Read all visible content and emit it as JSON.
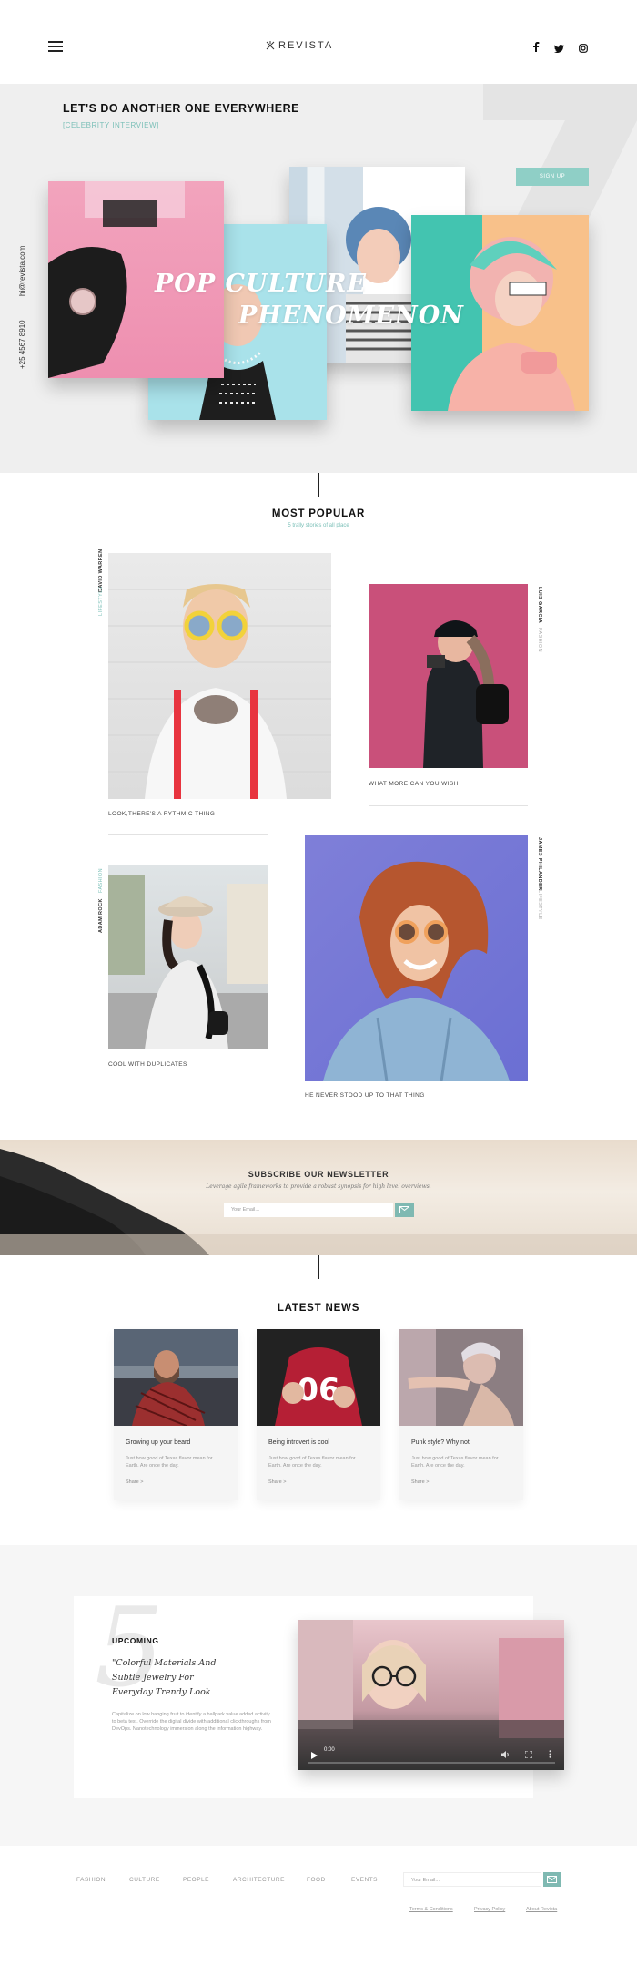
{
  "header": {
    "logo_text": "REVISTA",
    "social": {
      "facebook": "f",
      "twitter": "t",
      "instagram": "ig"
    }
  },
  "hero": {
    "title": "LET'S DO ANOTHER ONE EVERYWHERE",
    "subtitle": "[CELEBRITY INTERVIEW]",
    "cta_label": "SIGN UP",
    "headline_line1": "POP CULTURE",
    "headline_line2": "PHENOMENON",
    "contact_email": "hi@revista.com",
    "contact_phone": "+25 4567 8910"
  },
  "popular": {
    "title": "MOST POPULAR",
    "subtitle": "5 trally stories of all place",
    "items": [
      {
        "caption": "LOOK,THERE'S A RYTHMIC THING",
        "author": "DAVID WARREN",
        "tag": "LIFESTYLE"
      },
      {
        "caption": "WHAT MORE CAN YOU WISH",
        "author": "LUIS GARCIA",
        "tag": "FASHION"
      },
      {
        "caption": "COOL WITH DUPLICATES",
        "author": "ADAM ROCK",
        "tag": "FASHION"
      },
      {
        "caption": "HE NEVER STOOD UP TO THAT THING",
        "author": "JAMES PHILANDER",
        "tag": "LIFESTYLE"
      }
    ]
  },
  "newsletter": {
    "title": "SUBSCRIBE OUR NEWSLETTER",
    "subtitle": "Leverage agile frameworks to provide a robust synopsis for high level overviews.",
    "placeholder": "Your Email..."
  },
  "latest_news": {
    "title": "LATEST NEWS",
    "cards": [
      {
        "title": "Growing up your beard",
        "text": "Just how good of Texas flavor mean for Earth. Are once the day.",
        "link": "Share  >"
      },
      {
        "title": "Being introvert is cool",
        "text": "Just how good of Texas flavor mean for Earth. Are once the day.",
        "link": "Share  >"
      },
      {
        "title": "Punk style? Why not",
        "text": "Just how good of Texas flavor mean for Earth. Are once the day.",
        "link": "Share  >"
      }
    ]
  },
  "upcoming": {
    "number": "5",
    "label": "UPCOMING",
    "quote": "\"Colorful Materials And Subtle Jewelry For Everyday Trendy Look",
    "text": "Capitalize on low hanging fruit to identify a ballpark value added activity to beta test. Override the digital divide with additional clickthroughs from DevOps. Nanotechnology immersion along the information highway.",
    "video_time": "0:00"
  },
  "footer": {
    "nav": [
      "FASHION",
      "CULTURE",
      "PEOPLE",
      "ARCHITECTURE",
      "FOOD",
      "EVENTS"
    ],
    "placeholder": "Your Email...",
    "links": [
      "Terms & Conditions",
      "Privacy Policy",
      "About Revista"
    ]
  },
  "colors": {
    "accent": "#8fcfc6",
    "dark": "#111111",
    "muted": "#999999"
  }
}
